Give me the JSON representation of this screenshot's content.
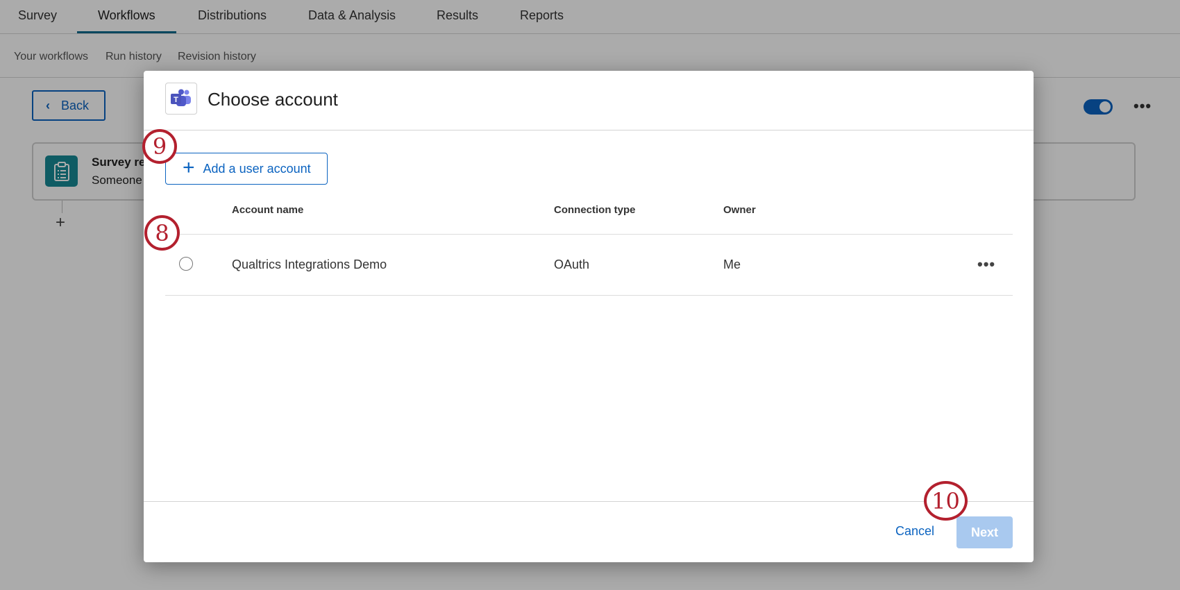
{
  "top_nav": {
    "tabs": [
      {
        "label": "Survey"
      },
      {
        "label": "Workflows"
      },
      {
        "label": "Distributions"
      },
      {
        "label": "Data & Analysis"
      },
      {
        "label": "Results"
      },
      {
        "label": "Reports"
      }
    ],
    "active_tab": "Workflows"
  },
  "sub_nav": {
    "items": [
      {
        "label": "Your workflows"
      },
      {
        "label": "Run history"
      },
      {
        "label": "Revision history"
      }
    ]
  },
  "workflow": {
    "back_label": "Back",
    "enabled": true,
    "more_icon": "ellipsis-icon",
    "trigger": {
      "title": "Survey re",
      "subtitle": "Someone",
      "icon": "clipboard-icon"
    },
    "add_step_icon": "plus-icon"
  },
  "modal": {
    "title": "Choose account",
    "app_icon": "microsoft-teams-icon",
    "add_account_label": "Add a user account",
    "table": {
      "headers": [
        "Account name",
        "Connection type",
        "Owner"
      ],
      "rows": [
        {
          "account_name": "Qualtrics Integrations Demo",
          "connection_type": "OAuth",
          "owner": "Me",
          "selected": false
        }
      ]
    },
    "cancel_label": "Cancel",
    "next_label": "Next"
  },
  "step_markers": [
    {
      "number": "9"
    },
    {
      "number": "8"
    },
    {
      "number": "10"
    }
  ],
  "colors": {
    "accent": "#0b63c0",
    "marker": "#b3202e",
    "teal": "#178a96",
    "disabled_button": "#a9c9ef"
  }
}
